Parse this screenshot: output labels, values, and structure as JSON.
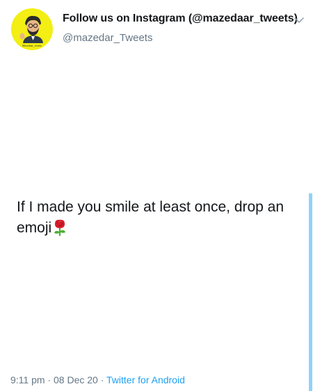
{
  "header": {
    "display_name": "Follow us on Instagram (@mazedaar_tweets)",
    "handle": "@mazedar_Tweets",
    "avatar_caption": "Mazedaar_tweets"
  },
  "tweet": {
    "text": "If I made you smile at least once, drop an emoji",
    "emoji": "rose-icon"
  },
  "meta": {
    "time": "9:11 pm",
    "date": "08 Dec 20",
    "separator": "·",
    "source": "Twitter for Android"
  },
  "icons": {
    "menu": "chevron-down-icon"
  },
  "colors": {
    "avatar_bg": "#f3ee14",
    "link": "#1da1f2",
    "secondary_text": "#657786",
    "scroll_indicator": "#8fd3f7"
  }
}
